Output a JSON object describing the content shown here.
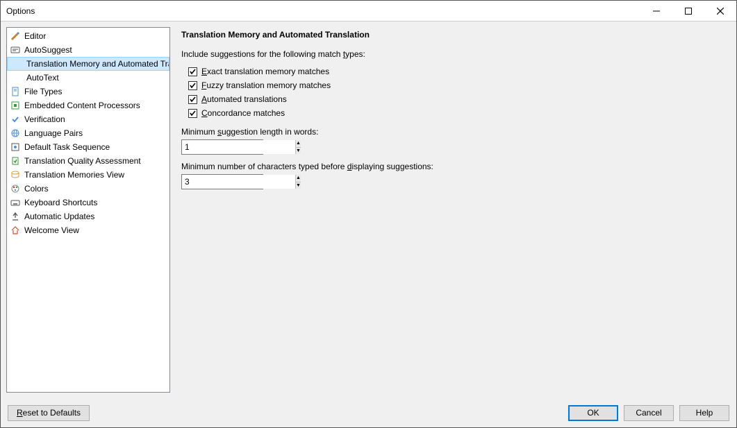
{
  "window": {
    "title": "Options"
  },
  "sidebar": {
    "items": [
      {
        "label": "Editor",
        "icon": "pencil-icon"
      },
      {
        "label": "AutoSuggest",
        "icon": "suggest-icon",
        "children": [
          {
            "label": "Translation Memory and Automated Trans",
            "selected": true
          },
          {
            "label": "AutoText"
          }
        ]
      },
      {
        "label": "File Types",
        "icon": "file-icon"
      },
      {
        "label": "Embedded Content Processors",
        "icon": "embed-icon"
      },
      {
        "label": "Verification",
        "icon": "verify-icon"
      },
      {
        "label": "Language Pairs",
        "icon": "globe-icon"
      },
      {
        "label": "Default Task Sequence",
        "icon": "task-icon"
      },
      {
        "label": "Translation Quality Assessment",
        "icon": "quality-icon"
      },
      {
        "label": "Translation Memories View",
        "icon": "tm-icon"
      },
      {
        "label": "Colors",
        "icon": "colors-icon"
      },
      {
        "label": "Keyboard Shortcuts",
        "icon": "keyboard-icon"
      },
      {
        "label": "Automatic Updates",
        "icon": "update-icon"
      },
      {
        "label": "Welcome View",
        "icon": "home-icon"
      }
    ]
  },
  "content": {
    "header": "Translation Memory and Automated Translation",
    "include_label_pre": "Include suggestions for the following match ",
    "include_label_u": "t",
    "include_label_post": "ypes:",
    "checks": [
      {
        "pre": "",
        "u": "E",
        "post": "xact translation memory matches",
        "checked": true
      },
      {
        "pre": "",
        "u": "F",
        "post": "uzzy translation memory matches",
        "checked": true
      },
      {
        "pre": "",
        "u": "A",
        "post": "utomated translations",
        "checked": true
      },
      {
        "pre": "",
        "u": "C",
        "post": "oncordance matches",
        "checked": true
      }
    ],
    "min_length": {
      "label_pre": "Minimum ",
      "label_u": "s",
      "label_mid": "uggestion length in words:",
      "value": "1"
    },
    "min_chars": {
      "label_pre": "Minimum number of characters typed before ",
      "label_u": "d",
      "label_mid": "isplaying suggestions:",
      "value": "3"
    }
  },
  "footer": {
    "reset_pre": "",
    "reset_u": "R",
    "reset_post": "eset to Defaults",
    "ok": "OK",
    "cancel": "Cancel",
    "help": "Help"
  }
}
